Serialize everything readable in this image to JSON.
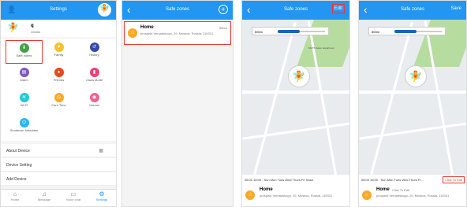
{
  "screen1": {
    "title": "Settings",
    "profile": {
      "name": "q",
      "sub": "Details"
    },
    "grid": [
      {
        "label": "Safe zones",
        "icon": "location-icon",
        "color": "#43a047"
      },
      {
        "label": "Family",
        "icon": "family-icon",
        "color": "#fbc02d"
      },
      {
        "label": "History",
        "icon": "history-icon",
        "color": "#3949ab"
      },
      {
        "label": "Alarm",
        "icon": "alarm-icon",
        "color": "#7e57c2"
      },
      {
        "label": "Friends",
        "icon": "friends-icon",
        "color": "#e64a19"
      },
      {
        "label": "Class Mode",
        "icon": "class-mode-icon",
        "color": "#ec407a"
      },
      {
        "label": "Wi-Fi",
        "icon": "wifi-icon",
        "color": "#26c6da"
      },
      {
        "label": "Care Time",
        "icon": "care-time-icon",
        "color": "#ffa726"
      },
      {
        "label": "Volume",
        "icon": "volume-icon",
        "color": "#f06292"
      },
      {
        "label": "Shutdown forbidden",
        "icon": "shutdown-icon",
        "color": "#29b6f6"
      }
    ],
    "rows": [
      "About Device",
      "Device Setting",
      "Add Device"
    ],
    "tabs": [
      "Home",
      "Message",
      "Voice chat",
      "Settings"
    ]
  },
  "screen2": {
    "title": "Safe zones",
    "item": {
      "name": "Home",
      "address": "prospekt Vernadskogo, 29, Moskva, Russia, 119331",
      "radius": "500m"
    }
  },
  "screen3": {
    "title": "Safe zones",
    "action": "Edit",
    "zoom": "500m",
    "schedule": "08:00 18:00 , Sun Mon Tues Wed Thurs Fri Satur",
    "home": "Home",
    "address": "prospekt Vernadskogo, 29, Moskva, Russia, 119331",
    "map_label": "MGTS Sales department"
  },
  "screen4": {
    "title": "Safe zones",
    "action": "Save",
    "zoom": "500m",
    "schedule": "08:00 18:00 , Sun Mon Tues Wed Thurs Fr...",
    "click_to_edit": "Click To Edit",
    "home": "Home",
    "home_hint": "Click To Edit",
    "address": "prospekt Vernadskogo, 29, Moskva, Russia, 119331"
  },
  "colors": {
    "primary": "#2196f3",
    "highlight": "#e53935"
  }
}
